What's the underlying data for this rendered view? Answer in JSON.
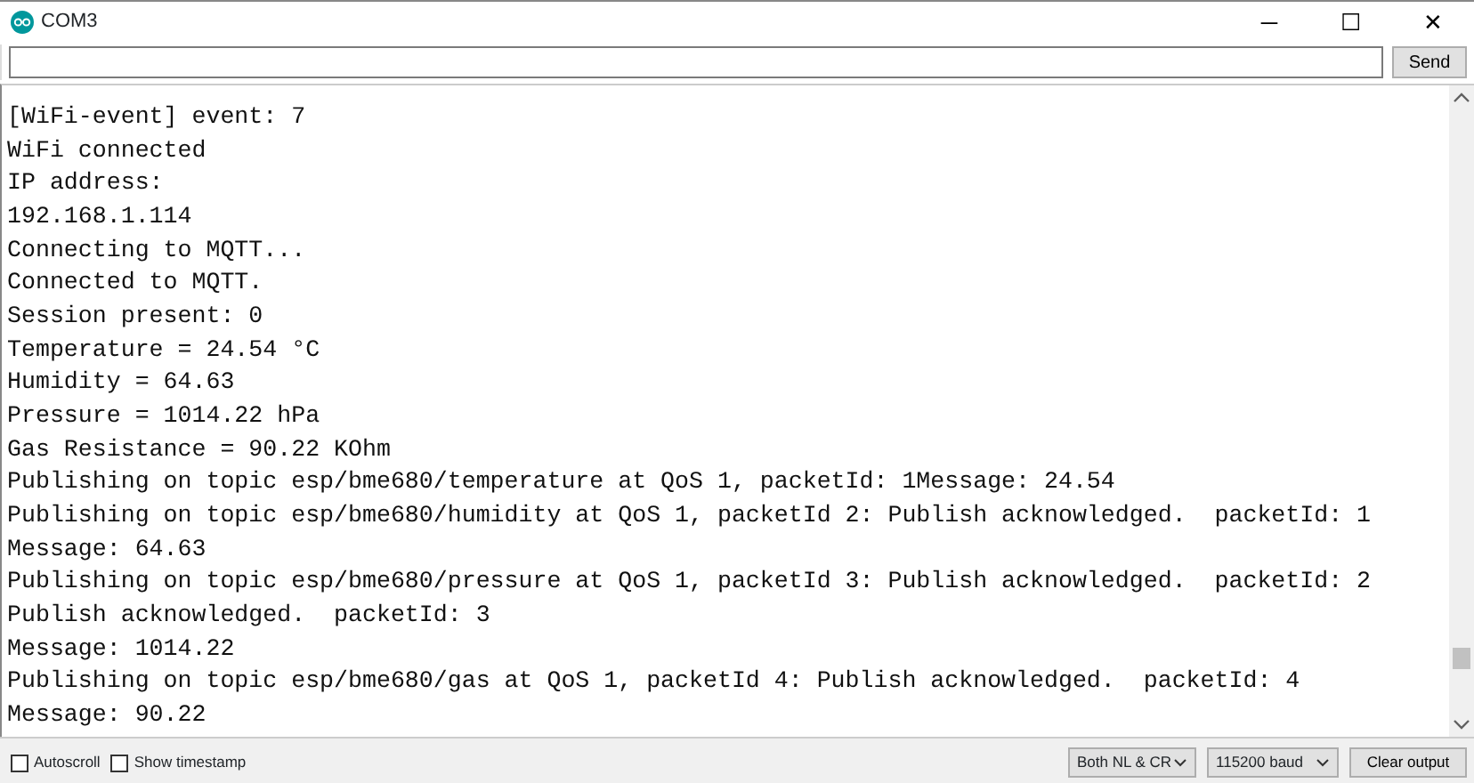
{
  "window": {
    "title": "COM3",
    "controls": [
      "─",
      "☐",
      "✕"
    ]
  },
  "input": {
    "button": "Send"
  },
  "log": {
    "lines": [
      "[WiFi-event] event: 7",
      "WiFi connected",
      "IP address:",
      "192.168.1.114",
      "Connecting to MQTT...",
      "Connected to MQTT.",
      "Session present: 0",
      "Temperature = 24.54 °C",
      "Humidity = 64.63",
      "Pressure = 1014.22 hPa",
      "Gas Resistance = 90.22 KOhm",
      "Publishing on topic esp/bme680/temperature at QoS 1, packetId: 1Message: 24.54",
      "Publishing on topic esp/bme680/humidity at QoS 1, packetId 2: Publish acknowledged.  packetId: 1",
      "Message: 64.63",
      "Publishing on topic esp/bme680/pressure at QoS 1, packetId 3: Publish acknowledged.  packetId: 2",
      "Publish acknowledged.  packetId: 3",
      "Message: 1014.22",
      "Publishing on topic esp/bme680/gas at QoS 1, packetId 4: Publish acknowledged.  packetId: 4",
      "Message: 90.22"
    ]
  },
  "footer": {
    "checkboxes": [
      {
        "label": "Autoscroll",
        "checked": false
      },
      {
        "label": "Show timestamp",
        "checked": false
      }
    ],
    "selects": [
      {
        "value": "Both NL & CR"
      },
      {
        "value": "115200 baud"
      }
    ],
    "button": "Clear output"
  }
}
